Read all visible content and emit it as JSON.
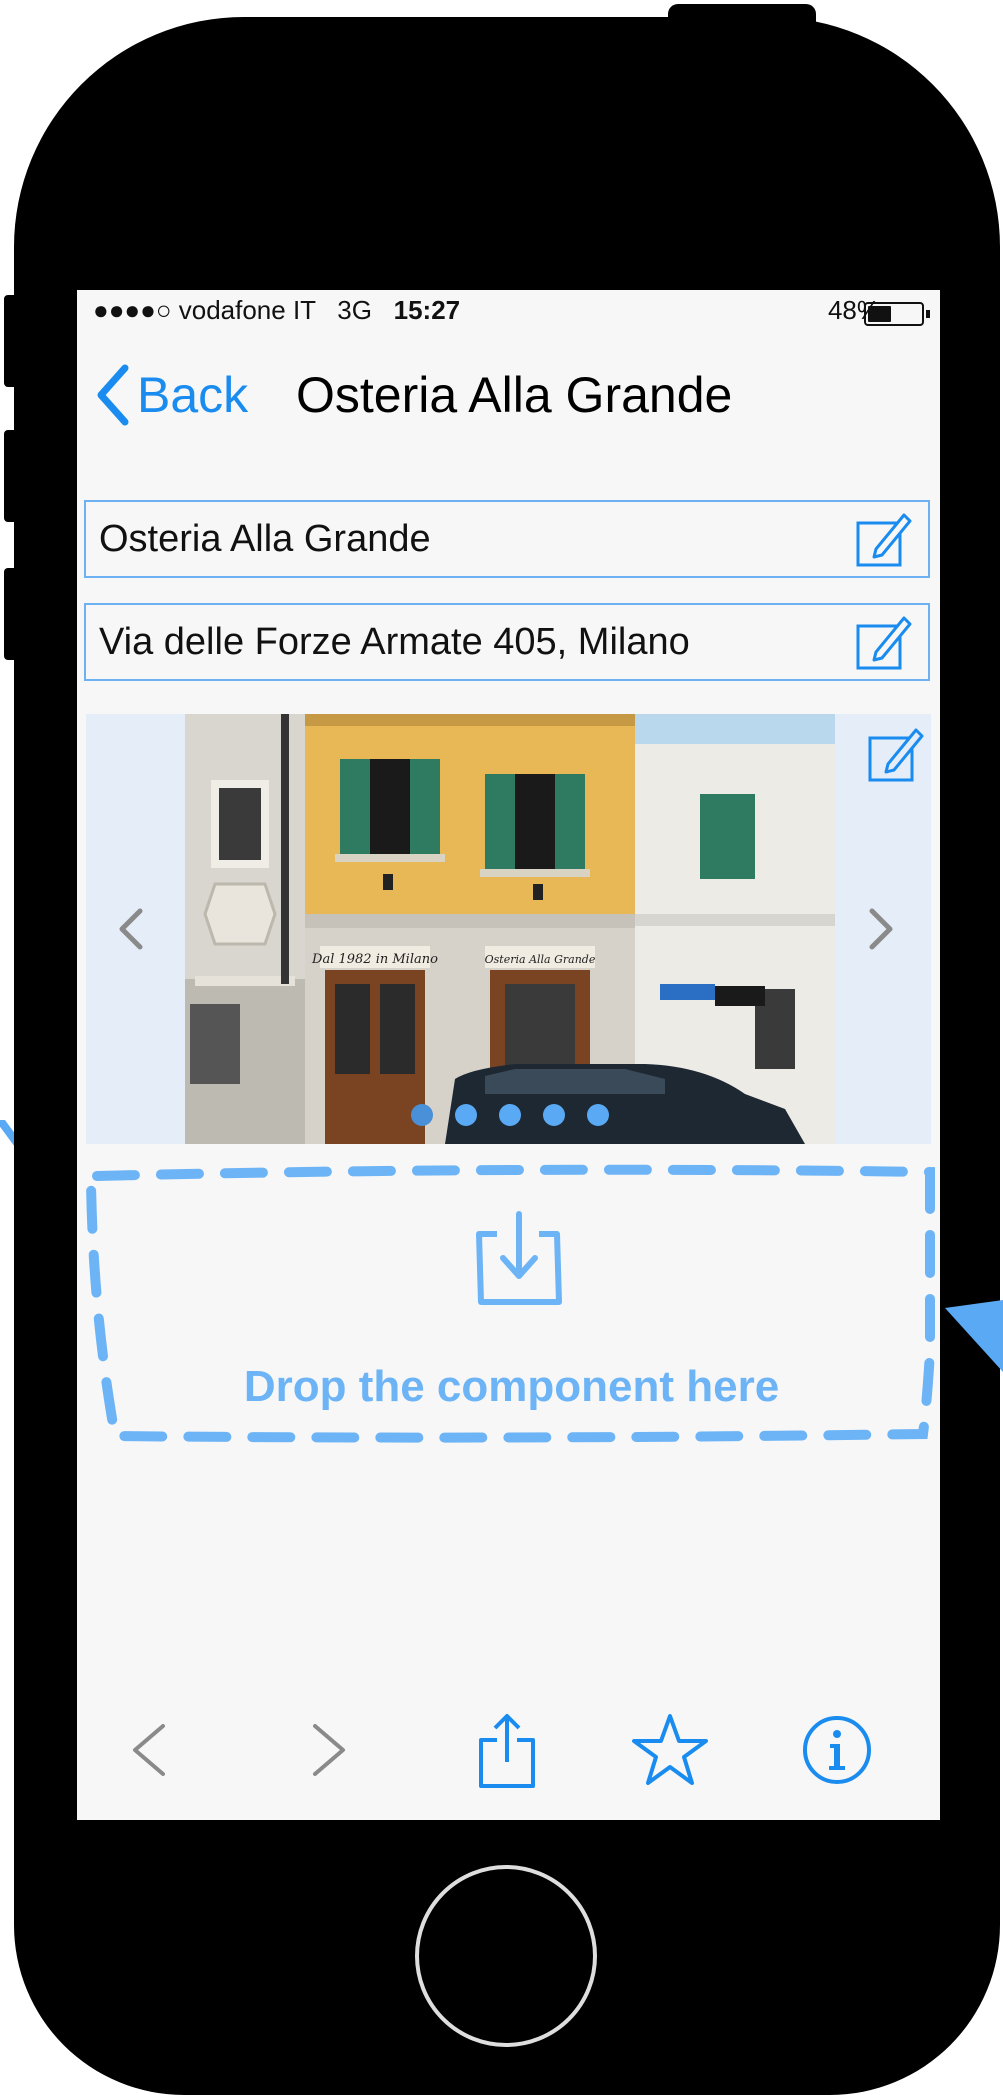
{
  "status_bar": {
    "carrier": "●●●●○ vodafone IT",
    "network": "3G",
    "time": "15:27",
    "battery": "48%",
    "battery_level": 0.48
  },
  "nav": {
    "back_label": "Back",
    "title": "Osteria Alla Grande"
  },
  "fields": {
    "name": "Osteria Alla Grande",
    "address": "Via delle Forze Armate 405, Milano"
  },
  "carousel": {
    "photo_signs": [
      "Dal 1982 in Milano",
      "Osteria Alla Grande"
    ],
    "page_count": 5,
    "active_page": 0
  },
  "drop_zone": {
    "label": "Drop the component here"
  },
  "toolbar": {
    "items": [
      "chevron-left-icon",
      "chevron-right-icon",
      "share-icon",
      "star-icon",
      "info-icon"
    ]
  },
  "colors": {
    "accent": "#1a8cf0",
    "drop_zone": "#6db4f6",
    "field_border": "#6eb1f2"
  }
}
